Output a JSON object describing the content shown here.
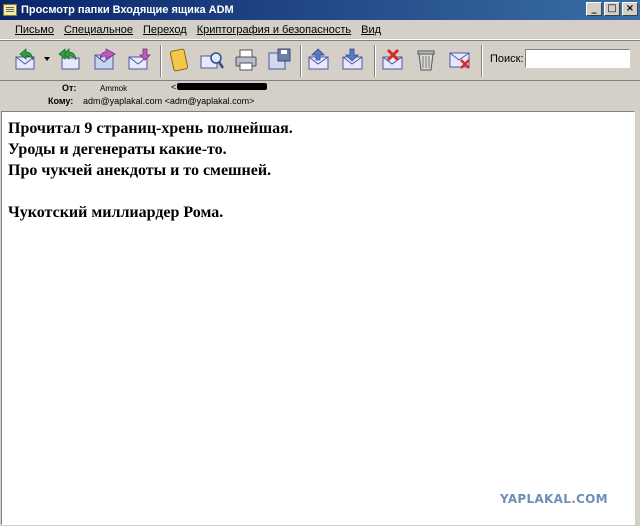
{
  "window": {
    "title": "Просмотр папки Входящие ящика ADM"
  },
  "menu": [
    "Письмо",
    "Специальное",
    "Переход",
    "Криптография и безопасность",
    "Вид"
  ],
  "toolbar": {
    "icons": [
      "reply-icon",
      "reply-all-icon",
      "forward-icon",
      "move-icon",
      "notes-icon",
      "search-mail-icon",
      "print-icon",
      "save-icon",
      "previous-icon",
      "next-icon",
      "delete-mark-icon",
      "trash-icon",
      "spam-icon"
    ],
    "search_label": "Поиск:",
    "search_value": ""
  },
  "header": {
    "from_label": "От:",
    "from_name": "Ammok",
    "from_bracket": "<",
    "to_label": "Кому:",
    "to_value": "adm@yaplakal.com <adm@yaplakal.com>"
  },
  "message": {
    "lines": [
      "Прочитал 9 страниц-хрень полнейшая.",
      "Уроды и дегенераты какие-то.",
      "Про чукчей анекдоты и то смешней.",
      "",
      "Чукотский миллиардер Рома."
    ]
  },
  "watermark": "YAPLAKAL.COM",
  "colors": {
    "title_bar": "#0a246a",
    "window_bg": "#d4d0c8",
    "watermark": "#6e8fb8"
  }
}
